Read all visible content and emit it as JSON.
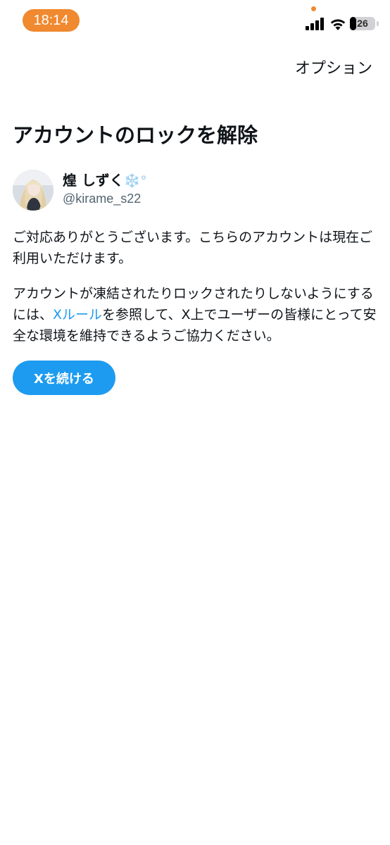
{
  "status_bar": {
    "time": "18:14",
    "battery_level": "26",
    "accent_color": "#f0892f"
  },
  "header": {
    "options_label": "オプション"
  },
  "main": {
    "title": "アカウントのロックを解除",
    "profile": {
      "display_name": "煌 しずく",
      "display_name_emoji": "❄️°",
      "handle": "@kirame_s22",
      "avatar_icon": "avatar-photo"
    },
    "paragraph1": "ご対応ありがとうございます。こちらのアカウントは現在ご利用いただけます。",
    "paragraph2_prefix": "アカウントが凍結されたりロックされたりしないようにするには、",
    "paragraph2_link": "Xルール",
    "paragraph2_suffix": "を参照して、X上でユーザーの皆様にとって安全な環境を維持できるようご協力ください。",
    "continue_button_label": "Xを続ける",
    "link_color": "#1d9bf0",
    "button_color": "#1d9bf0"
  }
}
